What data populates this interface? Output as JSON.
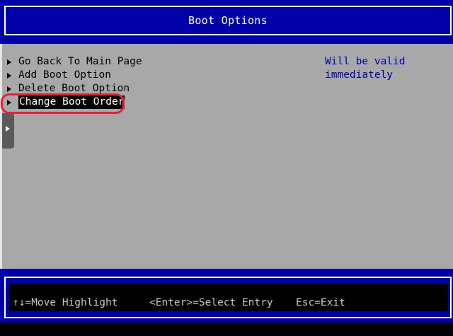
{
  "header": {
    "title": "Boot Options"
  },
  "menu": {
    "items": [
      {
        "label": "Go Back To Main Page"
      },
      {
        "label": "Add Boot Option"
      },
      {
        "label": "Delete Boot Option"
      },
      {
        "label": "Change Boot Order"
      }
    ],
    "selected_index": 3
  },
  "help": {
    "line1": "Will be valid",
    "line2": "immediately"
  },
  "footer": {
    "move": "↑↓=Move Highlight",
    "select": "<Enter>=Select Entry",
    "exit": "Esc=Exit"
  },
  "colors": {
    "bios_blue": "#0000a8",
    "panel_gray": "#a8a8a8",
    "highlight_red": "#e8203a"
  }
}
